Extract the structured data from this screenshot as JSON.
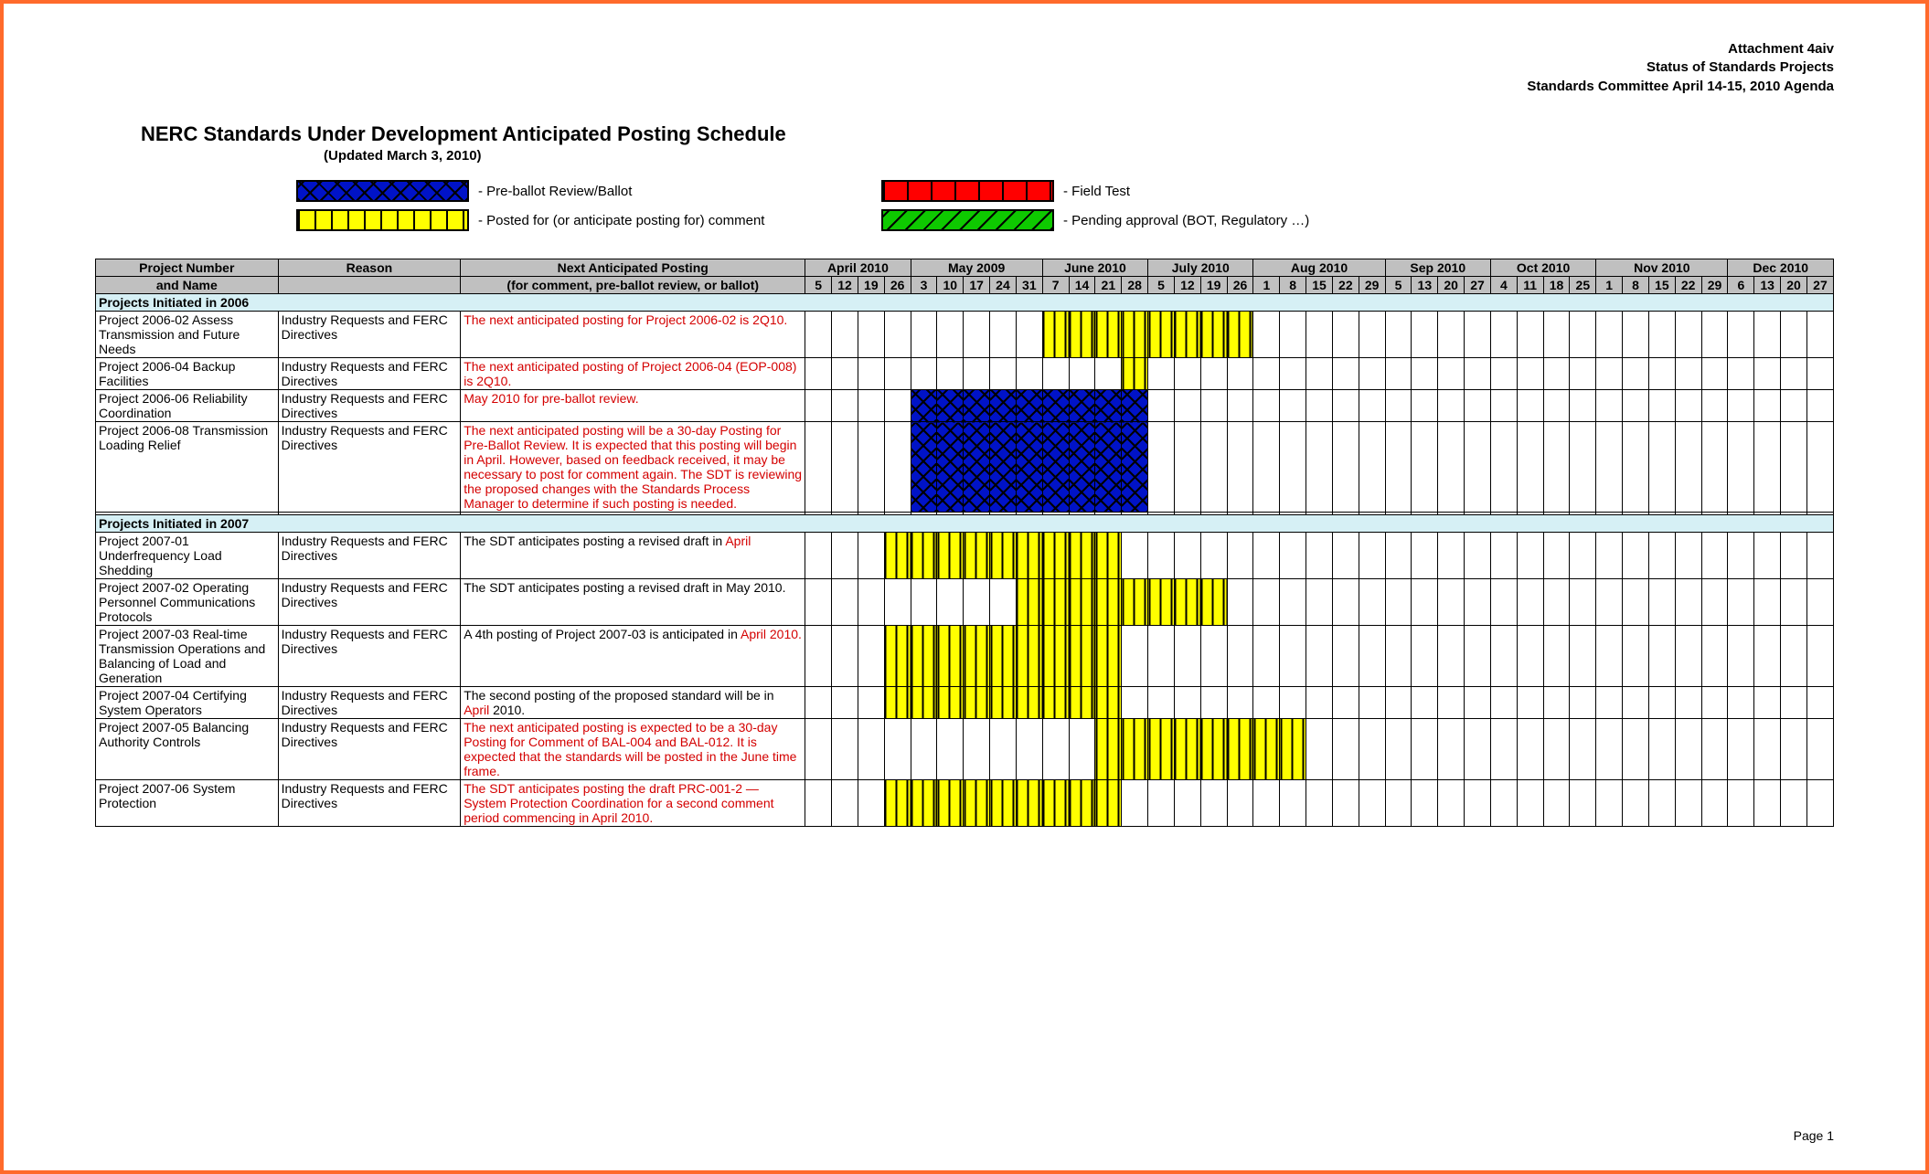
{
  "header_right": {
    "l1": "Attachment 4aiv",
    "l2": "Status of Standards Projects",
    "l3": "Standards Committee   April 14-15, 2010 Agenda"
  },
  "title": "NERC Standards Under Development Anticipated Posting Schedule",
  "subtitle": "(Updated March 3, 2010)",
  "legend": {
    "preballot": "- Pre-ballot Review/Ballot",
    "posted": "- Posted for (or anticipate posting for) comment",
    "fieldtest": "- Field Test",
    "pending": "- Pending approval (BOT, Regulatory …)"
  },
  "cols": {
    "project": "Project Number",
    "project2": "and Name",
    "reason": "Reason",
    "next": "Next Anticipated Posting",
    "next2": "(for comment, pre-ballot review, or ballot)"
  },
  "months": [
    {
      "label": "April 2010",
      "weeks": [
        "5",
        "12",
        "19",
        "26"
      ]
    },
    {
      "label": "May 2009",
      "weeks": [
        "3",
        "10",
        "17",
        "24",
        "31"
      ]
    },
    {
      "label": "June 2010",
      "weeks": [
        "7",
        "14",
        "21",
        "28"
      ]
    },
    {
      "label": "July 2010",
      "weeks": [
        "5",
        "12",
        "19",
        "26"
      ]
    },
    {
      "label": "Aug 2010",
      "weeks": [
        "1",
        "8",
        "15",
        "22",
        "29"
      ]
    },
    {
      "label": "Sep 2010",
      "weeks": [
        "5",
        "13",
        "20",
        "27"
      ]
    },
    {
      "label": "Oct 2010",
      "weeks": [
        "4",
        "11",
        "18",
        "25"
      ]
    },
    {
      "label": "Nov 2010",
      "weeks": [
        "1",
        "8",
        "15",
        "22",
        "29"
      ]
    },
    {
      "label": "Dec 2010",
      "weeks": [
        "6",
        "13",
        "20",
        "27"
      ]
    }
  ],
  "sections": [
    {
      "title": "Projects Initiated in 2006",
      "rows": [
        {
          "proj": "Project 2006-02 Assess Transmission and Future Needs",
          "reason": "Industry Requests and FERC Directives",
          "next": "The next anticipated posting for Project 2006-02 is 2Q10.",
          "next_red": true,
          "bars": [
            {
              "type": "yellow",
              "from": 9,
              "to": 16
            }
          ]
        },
        {
          "proj": "Project 2006-04 Backup Facilities",
          "reason": "Industry Requests and FERC Directives",
          "next": "The next anticipated posting of Project 2006-04 (EOP-008) is 2Q10.",
          "next_red": true,
          "bars": [
            {
              "type": "yellow",
              "from": 12,
              "to": 12
            }
          ]
        },
        {
          "proj": "Project 2006-06 Reliability Coordination",
          "reason": "Industry Requests and FERC Directives",
          "next": "May 2010 for pre-ballot review.",
          "next_red": true,
          "bars": [
            {
              "type": "blue",
              "from": 4,
              "to": 12
            }
          ]
        },
        {
          "proj": "Project 2006-08 Transmission Loading Relief",
          "reason": "Industry Requests and FERC Directives",
          "next": "The next anticipated posting will be a 30-day Posting for Pre-Ballot Review.  It is expected that this posting will begin in April.  However, based on feedback received, it may be necessary to post for comment again.  The SDT is reviewing the proposed changes with the Standards Process Manager to determine if such posting is needed.",
          "next_red": true,
          "bars": [
            {
              "type": "blue",
              "from": 4,
              "to": 12
            }
          ]
        },
        {
          "spacer": true
        }
      ]
    },
    {
      "title": "Projects Initiated in 2007",
      "rows": [
        {
          "proj": "Project 2007-01 Underfrequency Load Shedding",
          "reason": "Industry Requests and FERC Directives",
          "next_html": "The SDT anticipates posting a revised draft in <span class='hl'>April</span>",
          "bars": [
            {
              "type": "yellow",
              "from": 3,
              "to": 11
            }
          ]
        },
        {
          "proj": "Project 2007-02 Operating Personnel Communications Protocols",
          "reason": "Industry Requests and FERC Directives",
          "next": "The SDT anticipates posting a revised draft in May 2010.",
          "bars": [
            {
              "type": "yellow",
              "from": 8,
              "to": 15
            }
          ]
        },
        {
          "proj": "Project 2007-03 Real-time Transmission Operations and Balancing of Load and Generation",
          "reason": "Industry Requests and FERC Directives",
          "next_html": "A 4th posting of Project 2007-03 is anticipated in <span class='hl'>April 2010.</span>",
          "bars": [
            {
              "type": "yellow",
              "from": 3,
              "to": 11
            }
          ]
        },
        {
          "proj": "Project 2007-04 Certifying System Operators",
          "reason": "Industry Requests and FERC Directives",
          "next_html": "The second posting of the proposed standard will be in <span class='hl'>April</span> 2010.",
          "bars": [
            {
              "type": "yellow",
              "from": 3,
              "to": 11
            }
          ]
        },
        {
          "proj": "Project 2007-05 Balancing Authority Controls",
          "reason": "Industry Requests and FERC Directives",
          "next": "The next anticipated posting is expected to be a 30-day Posting for Comment of BAL-004 and BAL-012.  It is expected that the standards will be posted in the June time frame.",
          "next_red": true,
          "bars": [
            {
              "type": "yellow",
              "from": 11,
              "to": 18
            }
          ]
        },
        {
          "proj": "Project 2007-06 System Protection",
          "reason": "Industry Requests and FERC Directives",
          "next": "The SDT anticipates posting the draft PRC-001-2 — System Protection Coordination for a second comment period commencing in April 2010.",
          "next_red": true,
          "bars": [
            {
              "type": "yellow",
              "from": 3,
              "to": 11
            }
          ]
        }
      ]
    }
  ],
  "footer": "Page 1"
}
